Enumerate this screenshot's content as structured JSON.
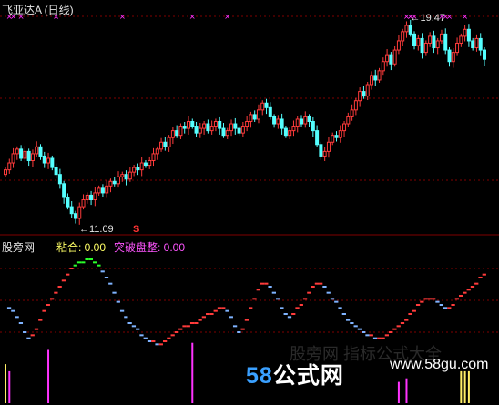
{
  "header": {
    "title": "飞亚达A (日线)"
  },
  "annotations": {
    "high_label": "19.47",
    "low_label": "11.09",
    "signal_glyph": "S",
    "cross_glyph": "×"
  },
  "indicator": {
    "name": "股旁网",
    "v1_label": "粘合: 0.00",
    "v2_label": "突破盘整: 0.00"
  },
  "watermark": {
    "main": "58公式网",
    "url": "www.58gu.com",
    "faint": "股旁网 指标公式大全"
  },
  "colors": {
    "up": "#ff3b3b",
    "down": "#54ffff",
    "line_up": "#ff3b3b",
    "line_down": "#7fb3ff",
    "line_peak": "#2aff2a",
    "bar": "#ff33ff",
    "bar_light": "#ffee66",
    "cross": "#ff33ff",
    "grid": "#800000"
  },
  "chart_data": {
    "type": "candlestick",
    "title": "飞亚达A (日线)",
    "y_high": 19.47,
    "y_low": 11.09,
    "closes": [
      13.2,
      13.5,
      13.9,
      14.1,
      13.7,
      14.0,
      13.6,
      13.9,
      14.2,
      13.8,
      13.5,
      13.7,
      13.3,
      13.0,
      12.6,
      12.0,
      11.6,
      11.3,
      11.09,
      11.6,
      11.9,
      12.1,
      11.9,
      12.2,
      12.4,
      12.2,
      12.5,
      12.7,
      12.6,
      12.9,
      13.0,
      12.8,
      13.1,
      13.3,
      13.2,
      13.5,
      13.4,
      13.6,
      13.9,
      14.1,
      14.4,
      14.2,
      14.6,
      14.9,
      14.7,
      15.1,
      15.0,
      15.3,
      15.1,
      14.8,
      15.0,
      15.2,
      14.9,
      15.1,
      15.3,
      15.0,
      14.7,
      14.9,
      15.2,
      15.0,
      14.8,
      15.1,
      15.3,
      15.6,
      15.4,
      15.8,
      16.1,
      15.9,
      15.5,
      15.2,
      15.4,
      15.0,
      14.7,
      14.9,
      15.1,
      15.4,
      15.2,
      15.5,
      15.3,
      14.9,
      14.3,
      13.8,
      14.0,
      14.4,
      14.7,
      14.6,
      14.9,
      15.2,
      15.5,
      15.8,
      16.2,
      16.6,
      16.4,
      16.9,
      17.3,
      17.1,
      17.5,
      17.9,
      18.2,
      17.8,
      18.4,
      18.8,
      19.2,
      19.47,
      19.1,
      18.6,
      18.9,
      18.3,
      18.7,
      19.0,
      18.5,
      18.8,
      19.1,
      18.4,
      17.9,
      18.3,
      18.7,
      19.0,
      19.3,
      18.8,
      18.5,
      18.9,
      18.4,
      18.0
    ],
    "xo_signals": [
      1,
      2,
      4,
      13,
      30,
      48,
      57,
      103,
      104,
      105,
      112,
      113,
      114,
      118
    ]
  },
  "indicator_data": {
    "line": [
      15,
      14,
      13,
      11,
      9,
      6,
      4,
      5,
      7,
      10,
      13,
      15,
      17,
      19,
      21,
      23,
      25,
      27,
      28,
      29,
      29,
      30,
      30,
      29,
      28,
      26,
      24,
      22,
      19,
      16,
      13,
      11,
      9,
      8,
      7,
      5,
      4,
      3,
      3,
      2,
      2,
      3,
      4,
      5,
      6,
      7,
      8,
      8,
      9,
      9,
      10,
      11,
      12,
      12,
      13,
      14,
      14,
      13,
      11,
      8,
      6,
      7,
      10,
      14,
      17,
      20,
      22,
      22,
      21,
      19,
      17,
      14,
      12,
      11,
      12,
      14,
      15,
      17,
      19,
      21,
      22,
      22,
      21,
      19,
      17,
      16,
      14,
      12,
      10,
      9,
      8,
      7,
      6,
      5,
      5,
      4,
      4,
      4,
      5,
      6,
      7,
      8,
      9,
      10,
      12,
      13,
      15,
      16,
      17,
      17,
      17,
      16,
      15,
      14,
      14,
      15,
      17,
      18,
      19,
      20,
      21,
      22,
      24,
      25
    ],
    "bars": [
      {
        "i": 0,
        "v": 0.55,
        "c": "bar_light"
      },
      {
        "i": 1,
        "v": 0.45,
        "c": "bar"
      },
      {
        "i": 11,
        "v": 0.75,
        "c": "bar"
      },
      {
        "i": 48,
        "v": 0.85,
        "c": "bar"
      },
      {
        "i": 101,
        "v": 0.3,
        "c": "bar"
      },
      {
        "i": 103,
        "v": 0.35,
        "c": "bar"
      },
      {
        "i": 117,
        "v": 0.45,
        "c": "bar_light"
      },
      {
        "i": 118,
        "v": 0.45,
        "c": "bar_light"
      },
      {
        "i": 119,
        "v": 0.45,
        "c": "bar_light"
      }
    ]
  }
}
